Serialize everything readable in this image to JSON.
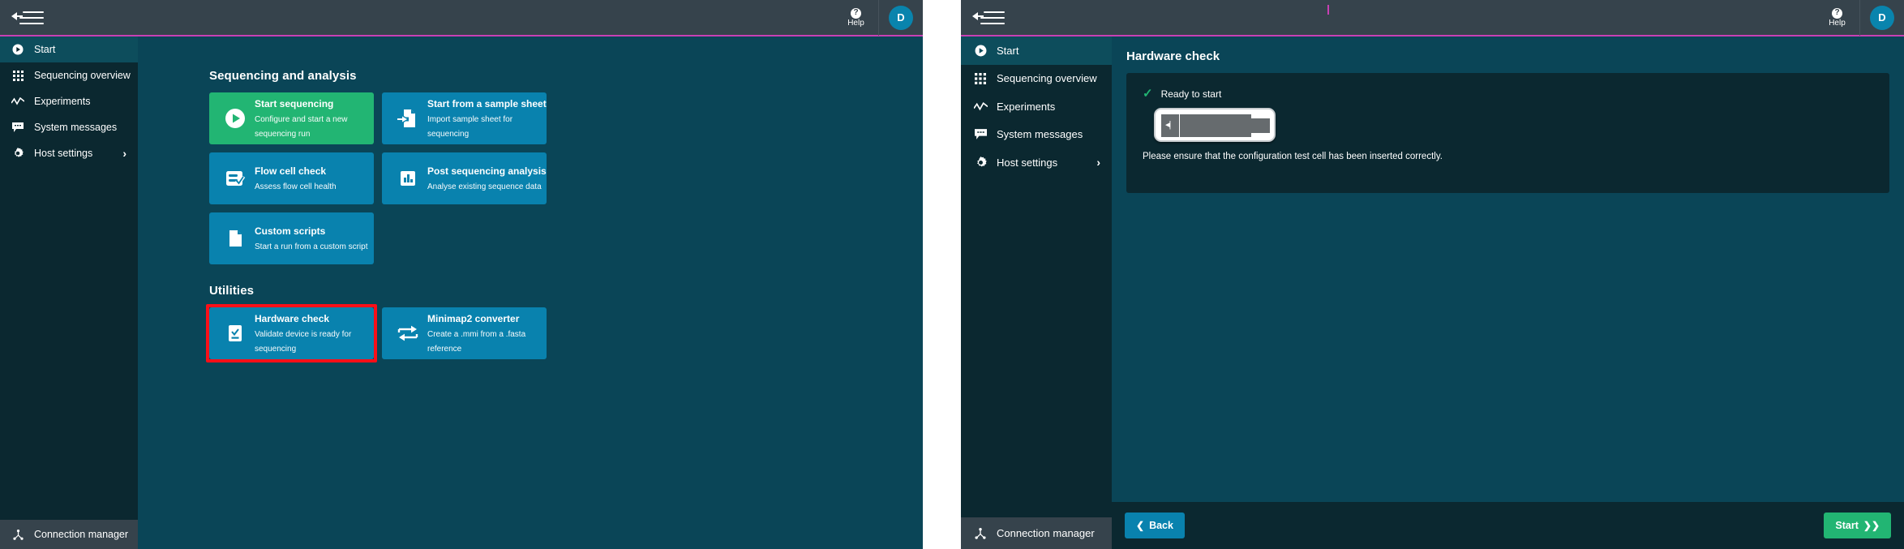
{
  "window": {
    "accent_pink": "#c840b4",
    "accent_blue": "#0982ae",
    "accent_green": "#22b573",
    "highlight_red": "#fb0f18",
    "sidebar_bg": "#0b2830",
    "main_bg": "#0a4557",
    "topbar_bg": "#36434c"
  },
  "topbar": {
    "menu_icon": "collapse-menu-icon",
    "help_label": "Help",
    "help_icon": "question-mark-icon",
    "avatar_initial": "D"
  },
  "sidebar": {
    "items": [
      {
        "label": "Start",
        "icon": "play-circle-icon",
        "active": true,
        "chevron": ""
      },
      {
        "label": "Sequencing overview",
        "icon": "grid-dots-icon",
        "active": false,
        "chevron": ""
      },
      {
        "label": "Experiments",
        "icon": "line-chart-icon",
        "active": false,
        "chevron": ""
      },
      {
        "label": "System messages",
        "icon": "chat-bubble-icon",
        "active": false,
        "chevron": ""
      },
      {
        "label": "Host settings",
        "icon": "gear-icon",
        "active": false,
        "chevron": "›"
      }
    ],
    "footer": {
      "label": "Connection manager",
      "icon": "network-node-icon"
    }
  },
  "left_panel": {
    "sections": [
      {
        "title": "Sequencing and analysis",
        "cards": [
          {
            "title": "Start sequencing",
            "subtitle": "Configure and start a new sequencing run",
            "icon": "play-circle-icon",
            "color": "green"
          },
          {
            "title": "Start from a sample sheet",
            "subtitle": "Import sample sheet for sequencing",
            "icon": "file-import-icon",
            "color": "blue"
          },
          {
            "title": "Flow cell check",
            "subtitle": "Assess flow cell health",
            "icon": "checklist-icon",
            "color": "blue"
          },
          {
            "title": "Post sequencing analysis",
            "subtitle": "Analyse existing sequence data",
            "icon": "bar-chart-icon",
            "color": "blue"
          },
          {
            "title": "Custom scripts",
            "subtitle": "Start a run from a custom script",
            "icon": "document-icon",
            "color": "blue"
          }
        ]
      },
      {
        "title": "Utilities",
        "cards": [
          {
            "title": "Hardware check",
            "subtitle": "Validate device is ready for sequencing",
            "icon": "hardware-check-icon",
            "color": "blue",
            "highlighted": true
          },
          {
            "title": "Minimap2 converter",
            "subtitle": "Create a .mmi from a .fasta reference",
            "icon": "convert-arrows-icon",
            "color": "blue"
          }
        ]
      }
    ]
  },
  "right_panel": {
    "page_title": "Hardware check",
    "status": {
      "icon": "check-icon",
      "label": "Ready to start"
    },
    "illustration": "flow-cell-graphic",
    "note": "Please ensure that the configuration test cell has been inserted correctly.",
    "footer": {
      "back_label": "Back",
      "back_icon": "chevron-left-icon",
      "start_label": "Start",
      "start_icon": "chevron-double-right-icon"
    }
  }
}
